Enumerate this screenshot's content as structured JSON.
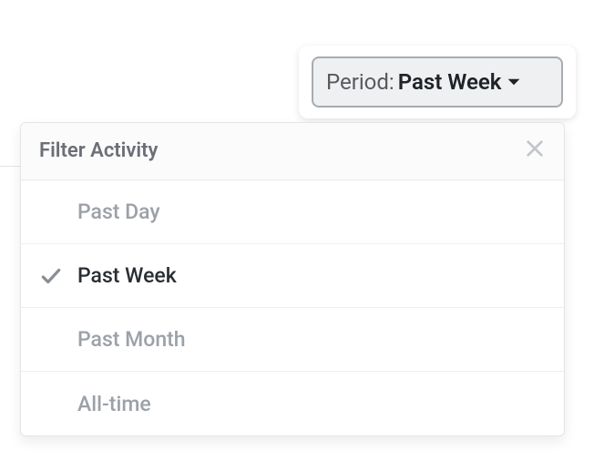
{
  "period_button": {
    "label": "Period:",
    "value": "Past Week"
  },
  "panel": {
    "title": "Filter Activity",
    "options": [
      {
        "label": "Past Day",
        "selected": false
      },
      {
        "label": "Past Week",
        "selected": true
      },
      {
        "label": "Past Month",
        "selected": false
      },
      {
        "label": "All-time",
        "selected": false
      }
    ]
  }
}
